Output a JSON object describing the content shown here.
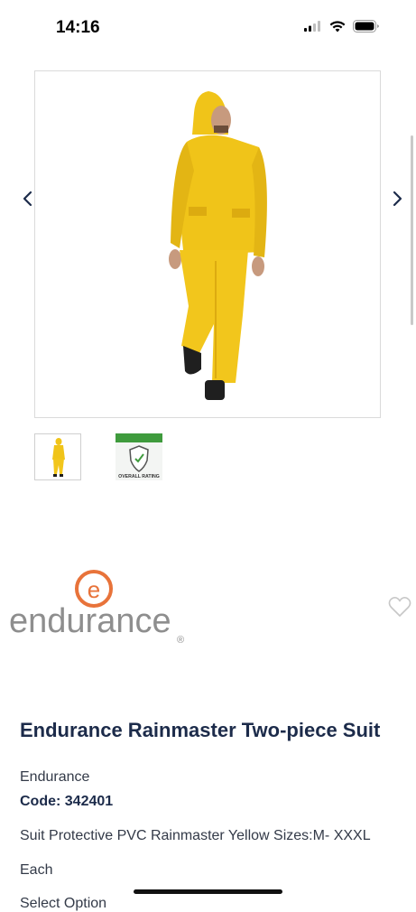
{
  "status_bar": {
    "time": "14:16"
  },
  "gallery": {
    "prev_label": "‹",
    "next_label": "›",
    "thumbnails": [
      "yellow-suit-thumbnail",
      "overall-rating-award-thumbnail"
    ],
    "award_thumb_text": "OVERALL RATING"
  },
  "brand_logo": {
    "text": "endurance",
    "letter": "e",
    "mark": "®"
  },
  "product": {
    "title": "Endurance Rainmaster Two-piece Suit",
    "brand": "Endurance",
    "code": "Code: 342401",
    "description": "Suit Protective PVC Rainmaster Yellow Sizes:M- XXXL",
    "unit": "Each",
    "select_option": "Select Option"
  },
  "colors": {
    "title": "#1c2b4a",
    "body": "#333a48",
    "brand_orange": "#e8733a",
    "logo_grey": "#8e8e8e",
    "suit_yellow": "#f0c419",
    "arrow": "#1c2b4a"
  }
}
